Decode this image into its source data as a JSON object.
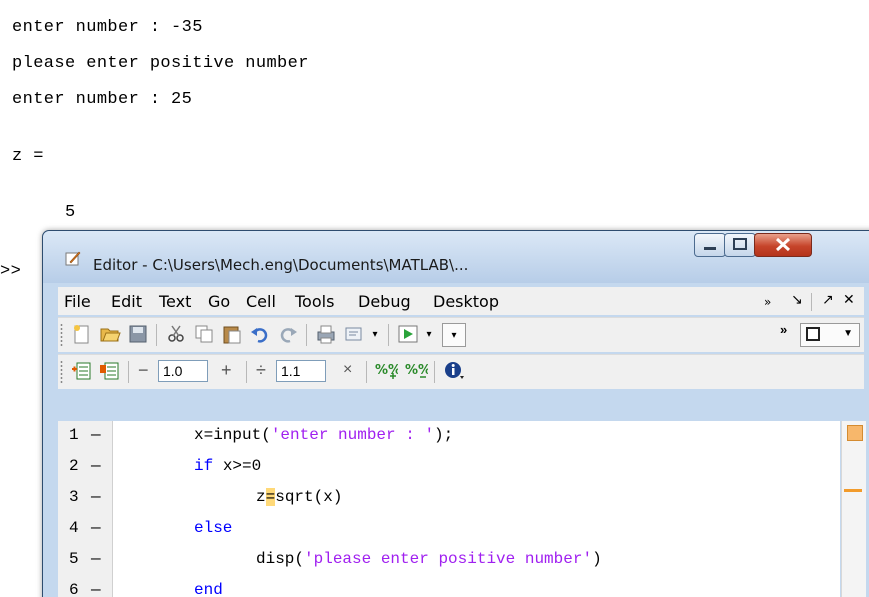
{
  "command_window": {
    "lines": [
      "enter number : -35",
      "please enter positive number",
      "enter number : 25",
      "",
      "z =",
      "",
      "     5",
      ">>"
    ]
  },
  "editor": {
    "title": "Editor - C:\\Users\\Mech.eng\\Documents\\MATLAB\\...",
    "menu": [
      "File",
      "Edit",
      "Text",
      "Go",
      "Cell",
      "Tools",
      "Debug",
      "Desktop"
    ],
    "menu_extras": [
      "»",
      "↘",
      "↗",
      "✕"
    ],
    "cell_toolbar": {
      "minus": "−",
      "value1": "1.0",
      "plus": "+",
      "divide": "÷",
      "value2": "1.1",
      "times": "×"
    },
    "code": [
      {
        "line": "1",
        "dash": "—",
        "indent": 0,
        "parts": [
          {
            "t": "x=input(",
            "c": ""
          },
          {
            "t": "'enter number : '",
            "c": "str"
          },
          {
            "t": ");",
            "c": ""
          }
        ]
      },
      {
        "line": "2",
        "dash": "—",
        "indent": 0,
        "parts": [
          {
            "t": "if ",
            "c": "kw"
          },
          {
            "t": "x>=0",
            "c": ""
          }
        ]
      },
      {
        "line": "3",
        "dash": "—",
        "indent": 1,
        "parts": [
          {
            "t": "z",
            "c": ""
          },
          {
            "t": "=",
            "c": "warn"
          },
          {
            "t": "sqrt(x)",
            "c": ""
          }
        ]
      },
      {
        "line": "4",
        "dash": "—",
        "indent": 0,
        "parts": [
          {
            "t": "else",
            "c": "kw"
          }
        ]
      },
      {
        "line": "5",
        "dash": "—",
        "indent": 1,
        "parts": [
          {
            "t": "disp(",
            "c": ""
          },
          {
            "t": "'please enter positive number'",
            "c": "str"
          },
          {
            "t": ")",
            "c": ""
          }
        ]
      },
      {
        "line": "6",
        "dash": "—",
        "indent": 0,
        "parts": [
          {
            "t": "end",
            "c": "kw"
          }
        ]
      }
    ]
  },
  "colors": {
    "keyword": "#0000ff",
    "string": "#a020f0",
    "warning": "#f29b2b"
  },
  "icons": [
    "editor-icon",
    "new-file-icon",
    "open-folder-icon",
    "save-icon",
    "cut-icon",
    "copy-icon",
    "paste-icon",
    "undo-icon",
    "redo-icon",
    "print-icon",
    "find-icon",
    "run-icon",
    "insert-cell-icon",
    "cell-mode-icon",
    "help-icon"
  ]
}
